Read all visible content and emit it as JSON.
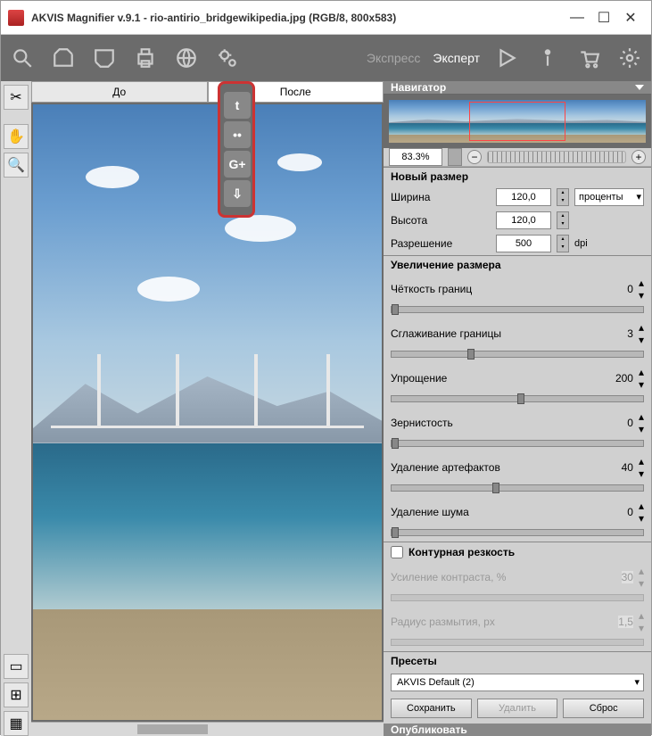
{
  "title": "AKVIS Magnifier v.9.1 - rio-antirio_bridgewikipedia.jpg (RGB/8, 800x583)",
  "toolbar": {
    "mode_express": "Экспресс",
    "mode_expert": "Эксперт"
  },
  "tabs": {
    "before": "До",
    "after": "После"
  },
  "share": {
    "twitter": "t",
    "flickr": "••",
    "gplus": "G+",
    "dropbox": "⇩"
  },
  "navigator": {
    "title": "Навигатор",
    "zoom": "83.3%"
  },
  "new_size": {
    "title": "Новый размер",
    "width_label": "Ширина",
    "width_val": "120,0",
    "height_label": "Высота",
    "height_val": "120,0",
    "res_label": "Разрешение",
    "res_val": "500",
    "units": "проценты",
    "res_units": "dpi"
  },
  "enlarge": {
    "title": "Увеличение размера",
    "edge_label": "Чёткость границ",
    "edge_val": "0",
    "smooth_label": "Сглаживание границы",
    "smooth_val": "3",
    "simplify_label": "Упрощение",
    "simplify_val": "200",
    "grain_label": "Зернистость",
    "grain_val": "0",
    "artifact_label": "Удаление артефактов",
    "artifact_val": "40",
    "noise_label": "Удаление шума",
    "noise_val": "0"
  },
  "unsharp": {
    "title": "Контурная резкость",
    "contrast_label": "Усиление контраста, %",
    "contrast_val": "30",
    "radius_label": "Радиус размытия, px",
    "radius_val": "1,5"
  },
  "presets": {
    "title": "Пресеты",
    "selected": "AKVIS Default (2)",
    "save": "Сохранить",
    "delete": "Удалить",
    "reset": "Сброс"
  },
  "publish": "Опубликовать"
}
